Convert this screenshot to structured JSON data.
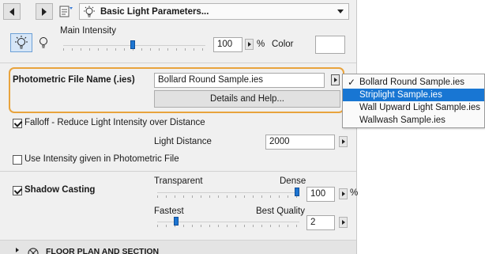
{
  "header": {
    "page_title": "Basic Light Parameters..."
  },
  "intensity": {
    "label": "Main Intensity",
    "value": "100",
    "unit": "%",
    "color_label": "Color",
    "slider_fraction": 0.49
  },
  "photometric": {
    "label": "Photometric File Name (.ies)",
    "value": "Bollard Round Sample.ies",
    "details_button": "Details and Help..."
  },
  "dropdown": {
    "items": [
      {
        "label": "Bollard Round Sample.ies",
        "checked": true,
        "selected": false
      },
      {
        "label": "Striplight Sample.ies",
        "checked": false,
        "selected": true
      },
      {
        "label": "Wall Upward Light Sample.ies",
        "checked": false,
        "selected": false
      },
      {
        "label": "Wallwash Sample.ies",
        "checked": false,
        "selected": false
      }
    ],
    "highlight_color": "#1876d3"
  },
  "falloff": {
    "label": "Falloff - Reduce Light Intensity over Distance",
    "checked": true,
    "distance_label": "Light Distance",
    "distance_value": "2000"
  },
  "use_intensity": {
    "label": "Use Intensity given in Photometric File",
    "checked": false
  },
  "shadow": {
    "label": "Shadow Casting",
    "checked": true,
    "density_min_label": "Transparent",
    "density_max_label": "Dense",
    "density_value": "100",
    "density_unit": "%",
    "density_fraction": 1.0,
    "quality_min_label": "Fastest",
    "quality_max_label": "Best Quality",
    "quality_value": "2",
    "quality_fraction": 0.12
  },
  "section": {
    "label": "FLOOR PLAN AND SECTION"
  },
  "colors": {
    "highlight_border": "#e8a33d",
    "slider_thumb": "#1d75d1"
  }
}
